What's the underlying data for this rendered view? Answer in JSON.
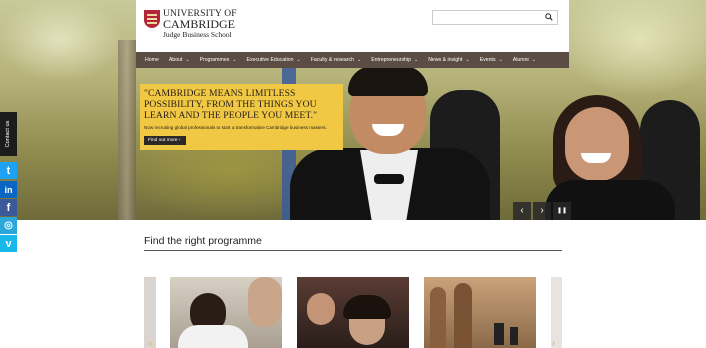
{
  "header": {
    "logo_line1": "UNIVERSITY OF",
    "logo_line2": "CAMBRIDGE",
    "logo_line3": "Judge Business School",
    "search_placeholder": ""
  },
  "nav": {
    "items": [
      {
        "label": "Home",
        "has_dropdown": false
      },
      {
        "label": "About",
        "has_dropdown": true
      },
      {
        "label": "Programmes",
        "has_dropdown": true
      },
      {
        "label": "Executive Education",
        "has_dropdown": true
      },
      {
        "label": "Faculty & research",
        "has_dropdown": true
      },
      {
        "label": "Entrepreneurship",
        "has_dropdown": true
      },
      {
        "label": "News & insight",
        "has_dropdown": true
      },
      {
        "label": "Events",
        "has_dropdown": true
      },
      {
        "label": "Alumni",
        "has_dropdown": true
      }
    ]
  },
  "hero": {
    "quote": "\"CAMBRIDGE MEANS LIMITLESS POSSIBILITY, FROM THE THINGS YOU LEARN AND THE PEOPLE YOU MEET.\"",
    "subtext": "Now recruiting global professionals to start a transformative Cambridge business masters.",
    "button_label": "Find out more ›",
    "controls": {
      "prev": "‹",
      "next": "›",
      "pause": "❚❚"
    }
  },
  "sidebar": {
    "contact_label": "Contact us",
    "social": [
      {
        "icon": "twitter-icon",
        "glyph": "t",
        "color": "#1da1f2"
      },
      {
        "icon": "linkedin-icon",
        "glyph": "in",
        "color": "#0a66c2"
      },
      {
        "icon": "facebook-icon",
        "glyph": "f",
        "color": "#3b5998"
      },
      {
        "icon": "instagram-icon",
        "glyph": "◎",
        "color": "#2ba8d9"
      },
      {
        "icon": "vimeo-icon",
        "glyph": "v",
        "color": "#1ab7ea"
      }
    ]
  },
  "programmes": {
    "title": "Find the right programme",
    "prev_arrow": "‹",
    "next_arrow": "›"
  },
  "colors": {
    "nav_bg": "#5b4d44",
    "quote_bg": "#f0c843",
    "accent": "#e5a52e"
  }
}
